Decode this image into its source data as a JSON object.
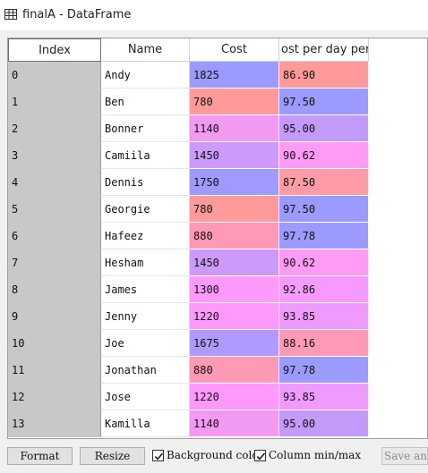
{
  "window": {
    "title": "finalA - DataFrame",
    "icon": "table-icon"
  },
  "table": {
    "headers": {
      "index": "Index",
      "name": "Name",
      "cost": "Cost",
      "rate": "ost per day per p"
    },
    "rows": [
      {
        "index": "0",
        "name": "Andy",
        "cost": "1825",
        "rate": "86.90",
        "cost_color": "#9a9aff",
        "rate_color": "#ff9a9a"
      },
      {
        "index": "1",
        "name": "Ben",
        "cost": "780",
        "rate": "97.50",
        "cost_color": "#ff9a9a",
        "rate_color": "#9a9aff"
      },
      {
        "index": "2",
        "name": "Bonner",
        "cost": "1140",
        "rate": "95.00",
        "cost_color": "#f29af2",
        "rate_color": "#c39afa"
      },
      {
        "index": "3",
        "name": "Camiila",
        "cost": "1450",
        "rate": "90.62",
        "cost_color": "#cd9afc",
        "rate_color": "#ff9af5"
      },
      {
        "index": "4",
        "name": "Dennis",
        "cost": "1750",
        "rate": "87.50",
        "cost_color": "#a09aff",
        "rate_color": "#ff9aa7"
      },
      {
        "index": "5",
        "name": "Georgie",
        "cost": "780",
        "rate": "97.50",
        "cost_color": "#ff9a9a",
        "rate_color": "#9a9aff"
      },
      {
        "index": "6",
        "name": "Hafeez",
        "cost": "880",
        "rate": "97.78",
        "cost_color": "#ff9ab6",
        "rate_color": "#9a9aff"
      },
      {
        "index": "7",
        "name": "Hesham",
        "cost": "1450",
        "rate": "90.62",
        "cost_color": "#cd9afc",
        "rate_color": "#ff9af5"
      },
      {
        "index": "8",
        "name": "James",
        "cost": "1300",
        "rate": "92.86",
        "cost_color": "#ff9afd",
        "rate_color": "#f79aff"
      },
      {
        "index": "9",
        "name": "Jenny",
        "cost": "1220",
        "rate": "93.85",
        "cost_color": "#ff9afc",
        "rate_color": "#ee9aff"
      },
      {
        "index": "10",
        "name": "Joe",
        "cost": "1675",
        "rate": "88.16",
        "cost_color": "#b09aff",
        "rate_color": "#ff9ab6"
      },
      {
        "index": "11",
        "name": "Jonathan",
        "cost": "880",
        "rate": "97.78",
        "cost_color": "#ff9ab6",
        "rate_color": "#9a9aff"
      },
      {
        "index": "12",
        "name": "Jose",
        "cost": "1220",
        "rate": "93.85",
        "cost_color": "#ff9afc",
        "rate_color": "#ee9aff"
      },
      {
        "index": "13",
        "name": "Kamilla",
        "cost": "1140",
        "rate": "95.00",
        "cost_color": "#f29af2",
        "rate_color": "#c39afa"
      }
    ]
  },
  "controls": {
    "format_label": "Format",
    "resize_label": "Resize",
    "background_color": {
      "label": "Background color",
      "checked": true
    },
    "column_minmax": {
      "label": "Column min/max",
      "checked": true
    },
    "save_label": "Save and Close"
  }
}
